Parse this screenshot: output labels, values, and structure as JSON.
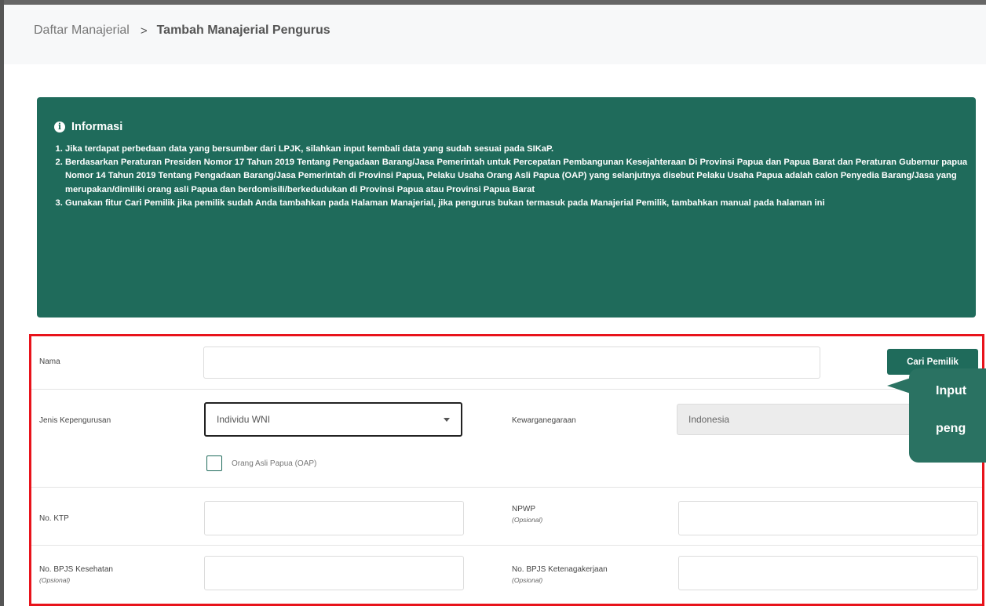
{
  "breadcrumb": {
    "parent": "Daftar Manajerial",
    "separator": ">",
    "current": "Tambah Manajerial Pengurus"
  },
  "info": {
    "title": "Informasi",
    "items": [
      "Jika terdapat perbedaan data yang bersumber dari LPJK, silahkan input kembali data yang sudah sesuai pada SIKaP.",
      "Berdasarkan Peraturan Presiden Nomor 17 Tahun 2019 Tentang Pengadaan Barang/Jasa Pemerintah untuk Percepatan Pembangunan Kesejahteraan Di Provinsi Papua dan Papua Barat dan Peraturan Gubernur papua Nomor 14 Tahun 2019 Tentang Pengadaan Barang/Jasa Pemerintah di Provinsi Papua, Pelaku Usaha Orang Asli Papua (OAP) yang selanjutnya disebut Pelaku Usaha Papua adalah calon Penyedia Barang/Jasa yang merupakan/dimiliki orang asli Papua dan berdomisili/berkedudukan di Provinsi Papua atau Provinsi Papua Barat",
      "Gunakan fitur Cari Pemilik jika pemilik sudah Anda tambahkan pada Halaman Manajerial, jika pengurus bukan termasuk pada Manajerial Pemilik, tambahkan manual pada halaman ini"
    ]
  },
  "form": {
    "nama_label": "Nama",
    "nama_value": "",
    "cari_pemilik_button": "Cari Pemilik",
    "jenis_label": "Jenis Kepengurusan",
    "jenis_value": "Individu WNI",
    "oap_label": "Orang Asli Papua (OAP)",
    "kewarganegaraan_label": "Kewarganegaraan",
    "kewarganegaraan_value": "Indonesia",
    "ktp_label": "No. KTP",
    "npwp_label": "NPWP",
    "npwp_sub": "(Opsional)",
    "bpjs_kes_label": "No. BPJS Kesehatan",
    "bpjs_kes_sub": "(Opsional)",
    "bpjs_tk_label": "No. BPJS Ketenagakerjaan",
    "bpjs_tk_sub": "(Opsional)"
  },
  "callout": {
    "line1": "Input",
    "line2": "peng"
  },
  "colors": {
    "primary": "#1f6b5b",
    "highlight_border": "#e8131b"
  }
}
